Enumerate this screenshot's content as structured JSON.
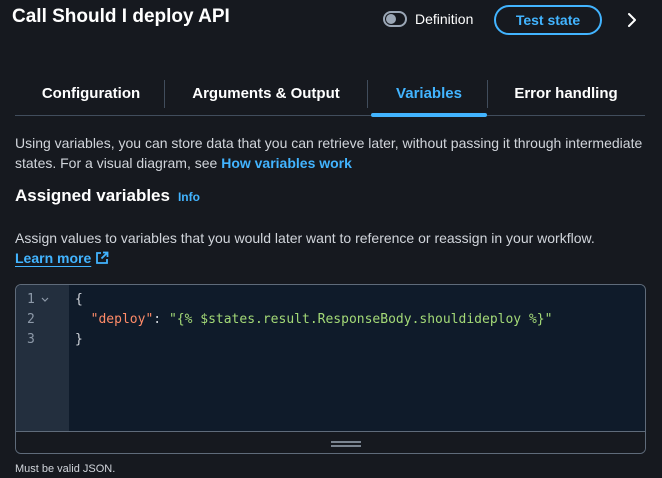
{
  "header": {
    "title": "Call Should I deploy API",
    "toggle_label": "Definition",
    "toggle_on": false,
    "test_button": "Test state",
    "expand_icon": "chevron-right-icon"
  },
  "tabs": [
    {
      "label": "Configuration",
      "active": false
    },
    {
      "label": "Arguments & Output",
      "active": false
    },
    {
      "label": "Variables",
      "active": true
    },
    {
      "label": "Error handling",
      "active": false
    }
  ],
  "description": {
    "text": "Using variables, you can store data that you can retrieve later, without passing it through intermediate states. For a visual diagram, see ",
    "link": "How variables work"
  },
  "assigned": {
    "title": "Assigned variables",
    "info": "Info",
    "description": "Assign values to variables that you would later want to reference or reassign in your workflow.",
    "learn_more": "Learn more"
  },
  "editor": {
    "line_numbers": [
      "1",
      "2",
      "3"
    ],
    "line1": "{",
    "line2_indent": "  ",
    "line2_key": "\"deploy\"",
    "line2_colon": ": ",
    "line2_value": "\"{% $states.result.ResponseBody.shouldideploy %}\"",
    "line3": "}"
  },
  "validation_hint": "Must be valid JSON.",
  "colors": {
    "background": "#16191f",
    "accent": "#42b4ff",
    "json_key": "#ff8b68",
    "json_string": "#a3d977"
  }
}
